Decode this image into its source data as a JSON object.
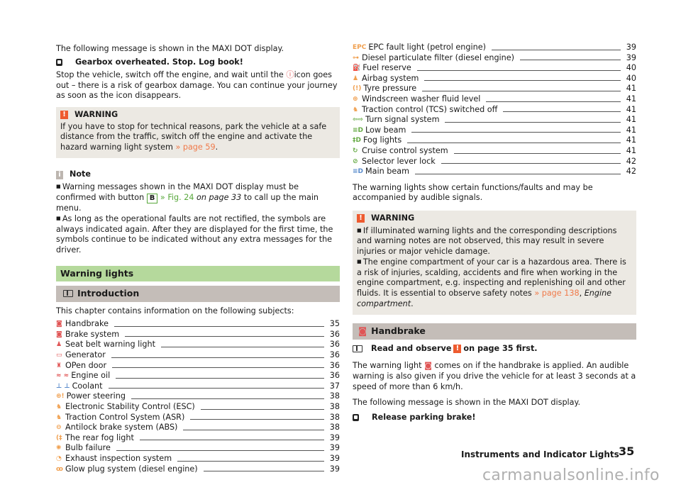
{
  "left": {
    "intro_text": "The following message is shown in the MAXI DOT display.",
    "display_msg_1": "Gearbox overheated. Stop. Log book!",
    "para1_a": "Stop the vehicle, switch off the engine, and wait until the ",
    "para1_icon": "ⓘ",
    "para1_b": "icon goes out – there is a risk of gearbox damage. You can continue your journey as soon as the icon disappears.",
    "warning": {
      "badge": "!",
      "title": "WARNING",
      "text": "If you have to stop for technical reasons, park the vehicle at a safe distance from the traffic, switch off the engine and activate the hazard warning light system ",
      "link": "» page 59",
      "end": "."
    },
    "note": {
      "badge": "i",
      "title": "Note",
      "b1_a": "Warning messages shown in the MAXI DOT display must be confirmed with button ",
      "b1_button": "B",
      "b1_link": " » Fig. 24",
      "b1_italic": " on page 33",
      "b1_b": " to call up the main menu.",
      "b2": "As long as the operational faults are not rectified, the symbols are always indicated again. After they are displayed for the first time, the symbols continue to be indicated without any extra messages for the driver."
    },
    "section_title": "Warning lights",
    "subsection_title": "Introduction",
    "toc_intro": "This chapter contains information on the following subjects:",
    "toc": [
      {
        "icon": "◙",
        "color": "red",
        "label": "Handbrake",
        "page": "35"
      },
      {
        "icon": "◙",
        "color": "red",
        "label": "Brake system",
        "page": "36"
      },
      {
        "icon": "♟",
        "color": "red",
        "label": "Seat belt warning light",
        "page": "36"
      },
      {
        "icon": "▭",
        "color": "red",
        "label": "Generator",
        "page": "36"
      },
      {
        "icon": "♜",
        "color": "red",
        "label": "OPen door",
        "page": "36"
      },
      {
        "icon": "≈ ≈",
        "color": "red",
        "label": "Engine oil",
        "page": "36"
      },
      {
        "icon": "⊥ ⊥",
        "color": "blue",
        "label": "Coolant",
        "page": "37"
      },
      {
        "icon": "⊛!",
        "color": "orange",
        "label": "Power steering",
        "page": "38"
      },
      {
        "icon": "♞",
        "color": "orange",
        "label": "Electronic Stability Control (ESC)",
        "page": "38"
      },
      {
        "icon": "♞",
        "color": "orange",
        "label": "Traction Control System (ASR)",
        "page": "38"
      },
      {
        "icon": "⊖",
        "color": "orange",
        "label": "Antilock brake system (ABS)",
        "page": "38"
      },
      {
        "icon": "(‡",
        "color": "orange",
        "label": "The rear fog light",
        "page": "39"
      },
      {
        "icon": "✺",
        "color": "orange",
        "label": "Bulb failure",
        "page": "39"
      },
      {
        "icon": "◔",
        "color": "orange",
        "label": "Exhaust inspection system",
        "page": "39"
      },
      {
        "icon": "ꝏ",
        "color": "orange",
        "label": "Glow plug system (diesel engine)",
        "page": "39"
      }
    ]
  },
  "right": {
    "toc": [
      {
        "icon": "EPC",
        "color": "orange",
        "label": "EPC fault light (petrol engine)",
        "page": "39"
      },
      {
        "icon": "⊶",
        "color": "orange",
        "label": "Diesel particulate filter (diesel engine)",
        "page": "39"
      },
      {
        "icon": "⛽",
        "color": "orange",
        "label": "Fuel reserve",
        "page": "40"
      },
      {
        "icon": "♟",
        "color": "orange",
        "label": "Airbag system",
        "page": "40"
      },
      {
        "icon": "(!)",
        "color": "orange",
        "label": "Tyre pressure",
        "page": "41"
      },
      {
        "icon": "⊕",
        "color": "orange",
        "label": "Windscreen washer fluid level",
        "page": "41"
      },
      {
        "icon": "♞",
        "color": "orange",
        "label": "Traction control (TCS) switched off",
        "page": "41"
      },
      {
        "icon": "⇦⇨",
        "color": "green",
        "label": "Turn signal system",
        "page": "41"
      },
      {
        "icon": "≡D",
        "color": "green",
        "label": "Low beam",
        "page": "41"
      },
      {
        "icon": "‡D",
        "color": "green",
        "label": "Fog lights",
        "page": "41"
      },
      {
        "icon": "↻",
        "color": "green",
        "label": "Cruise control system",
        "page": "41"
      },
      {
        "icon": "⊘",
        "color": "green",
        "label": "Selector lever lock",
        "page": "42"
      },
      {
        "icon": "≡D",
        "color": "blue",
        "label": "Main beam",
        "page": "42"
      }
    ],
    "after_toc": "The warning lights show certain functions/faults and may be accompanied by audible signals.",
    "warning": {
      "badge": "!",
      "title": "WARNING",
      "b1": "If illuminated warning lights and the corresponding descriptions and warning notes are not observed, this may result in severe injuries or major vehicle damage.",
      "b2_a": "The engine compartment of your car is a hazardous area. There is a risk of injuries, scalding, accidents and fire when working in the engine compartment, e.g. inspecting and replenishing oil and other fluids. It is essential to observe safety notes ",
      "b2_link": "» page 138",
      "b2_sep": ", ",
      "b2_italic": "Engine compartment",
      "b2_end": "."
    },
    "handbrake": {
      "icon": "◙",
      "title": "Handbrake",
      "read_a": "Read and observe ",
      "read_badge": "!",
      "read_b": " on page 35 first.",
      "para_a": "The warning light ",
      "para_icon": "◙",
      "para_b": " comes on if the handbrake is applied. An audible warning is also given if you drive the vehicle for at least 3 seconds at a speed of more than 6 km/h.",
      "intro": "The following message is shown in the MAXI DOT display.",
      "display_msg": "Release parking brake!"
    }
  },
  "footer": {
    "chapter": "Instruments and Indicator Lights",
    "page": "35"
  },
  "watermark": "carmanualsonline.info"
}
